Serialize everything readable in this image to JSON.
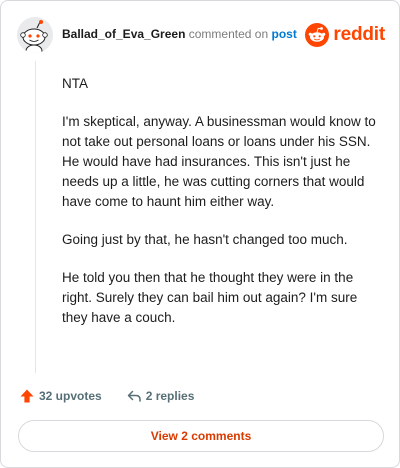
{
  "comment": {
    "username": "Ballad_of_Eva_Green",
    "action_text": "commented on",
    "post_link": "post",
    "paragraphs": [
      "NTA",
      "I'm skeptical, anyway. A businessman would know to not take out personal loans or loans under his SSN. He would have had insurances. This isn't just he needs up a little, he was cutting corners that would have come to haunt him either way.",
      "Going just by that, he hasn't changed too much.",
      "He told you then that he thought they were in the right. Surely they can bail him out again? I'm sure they have a couch."
    ]
  },
  "brand": {
    "wordmark": "reddit",
    "icon": "reddit-logo-icon",
    "color": "#ff4500"
  },
  "actions": {
    "upvotes": "32 upvotes",
    "upvote_icon": "upvote-arrow-icon",
    "replies": "2 replies",
    "reply_icon": "reply-arrow-icon"
  },
  "footer": {
    "view_comments": "View 2 comments",
    "accent": "#d93a00"
  }
}
